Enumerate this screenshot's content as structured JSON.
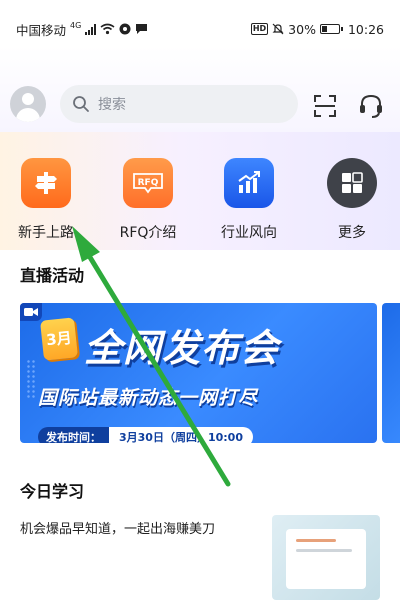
{
  "status_bar": {
    "carrier": "中国移动",
    "network": "4G",
    "battery": "30%",
    "battery_level": 0.3,
    "time": "10:26"
  },
  "header": {
    "search_placeholder": "搜索",
    "icons": [
      "avatar",
      "search-icon",
      "scan-icon",
      "customer-service-icon"
    ]
  },
  "quick_entries": [
    {
      "label": "新手上路",
      "icon": "beginner-icon",
      "color": "#ff7a2a"
    },
    {
      "label": "RFQ介绍",
      "icon": "rfq-icon",
      "color": "#ff7f36"
    },
    {
      "label": "行业风向",
      "icon": "trend-chart-icon",
      "color": "#2a66f0"
    },
    {
      "label": "更多",
      "icon": "more-grid-icon",
      "color": "#3f4249"
    }
  ],
  "live_section": {
    "title": "直播活动",
    "banner": {
      "month": "3月",
      "title": "全网发布会",
      "subtitle": "国际站最新动态一网打尽",
      "time_label": "发布时间：",
      "time_value": "3月30日（周四）10:00"
    }
  },
  "learning_section": {
    "title": "今日学习",
    "item_text": "机会爆品早知道，一起出海赚美刀"
  },
  "colors": {
    "accent_orange": "#ff7a2a",
    "accent_blue": "#2a66f0",
    "annotation_arrow": "#2eaa3c"
  }
}
